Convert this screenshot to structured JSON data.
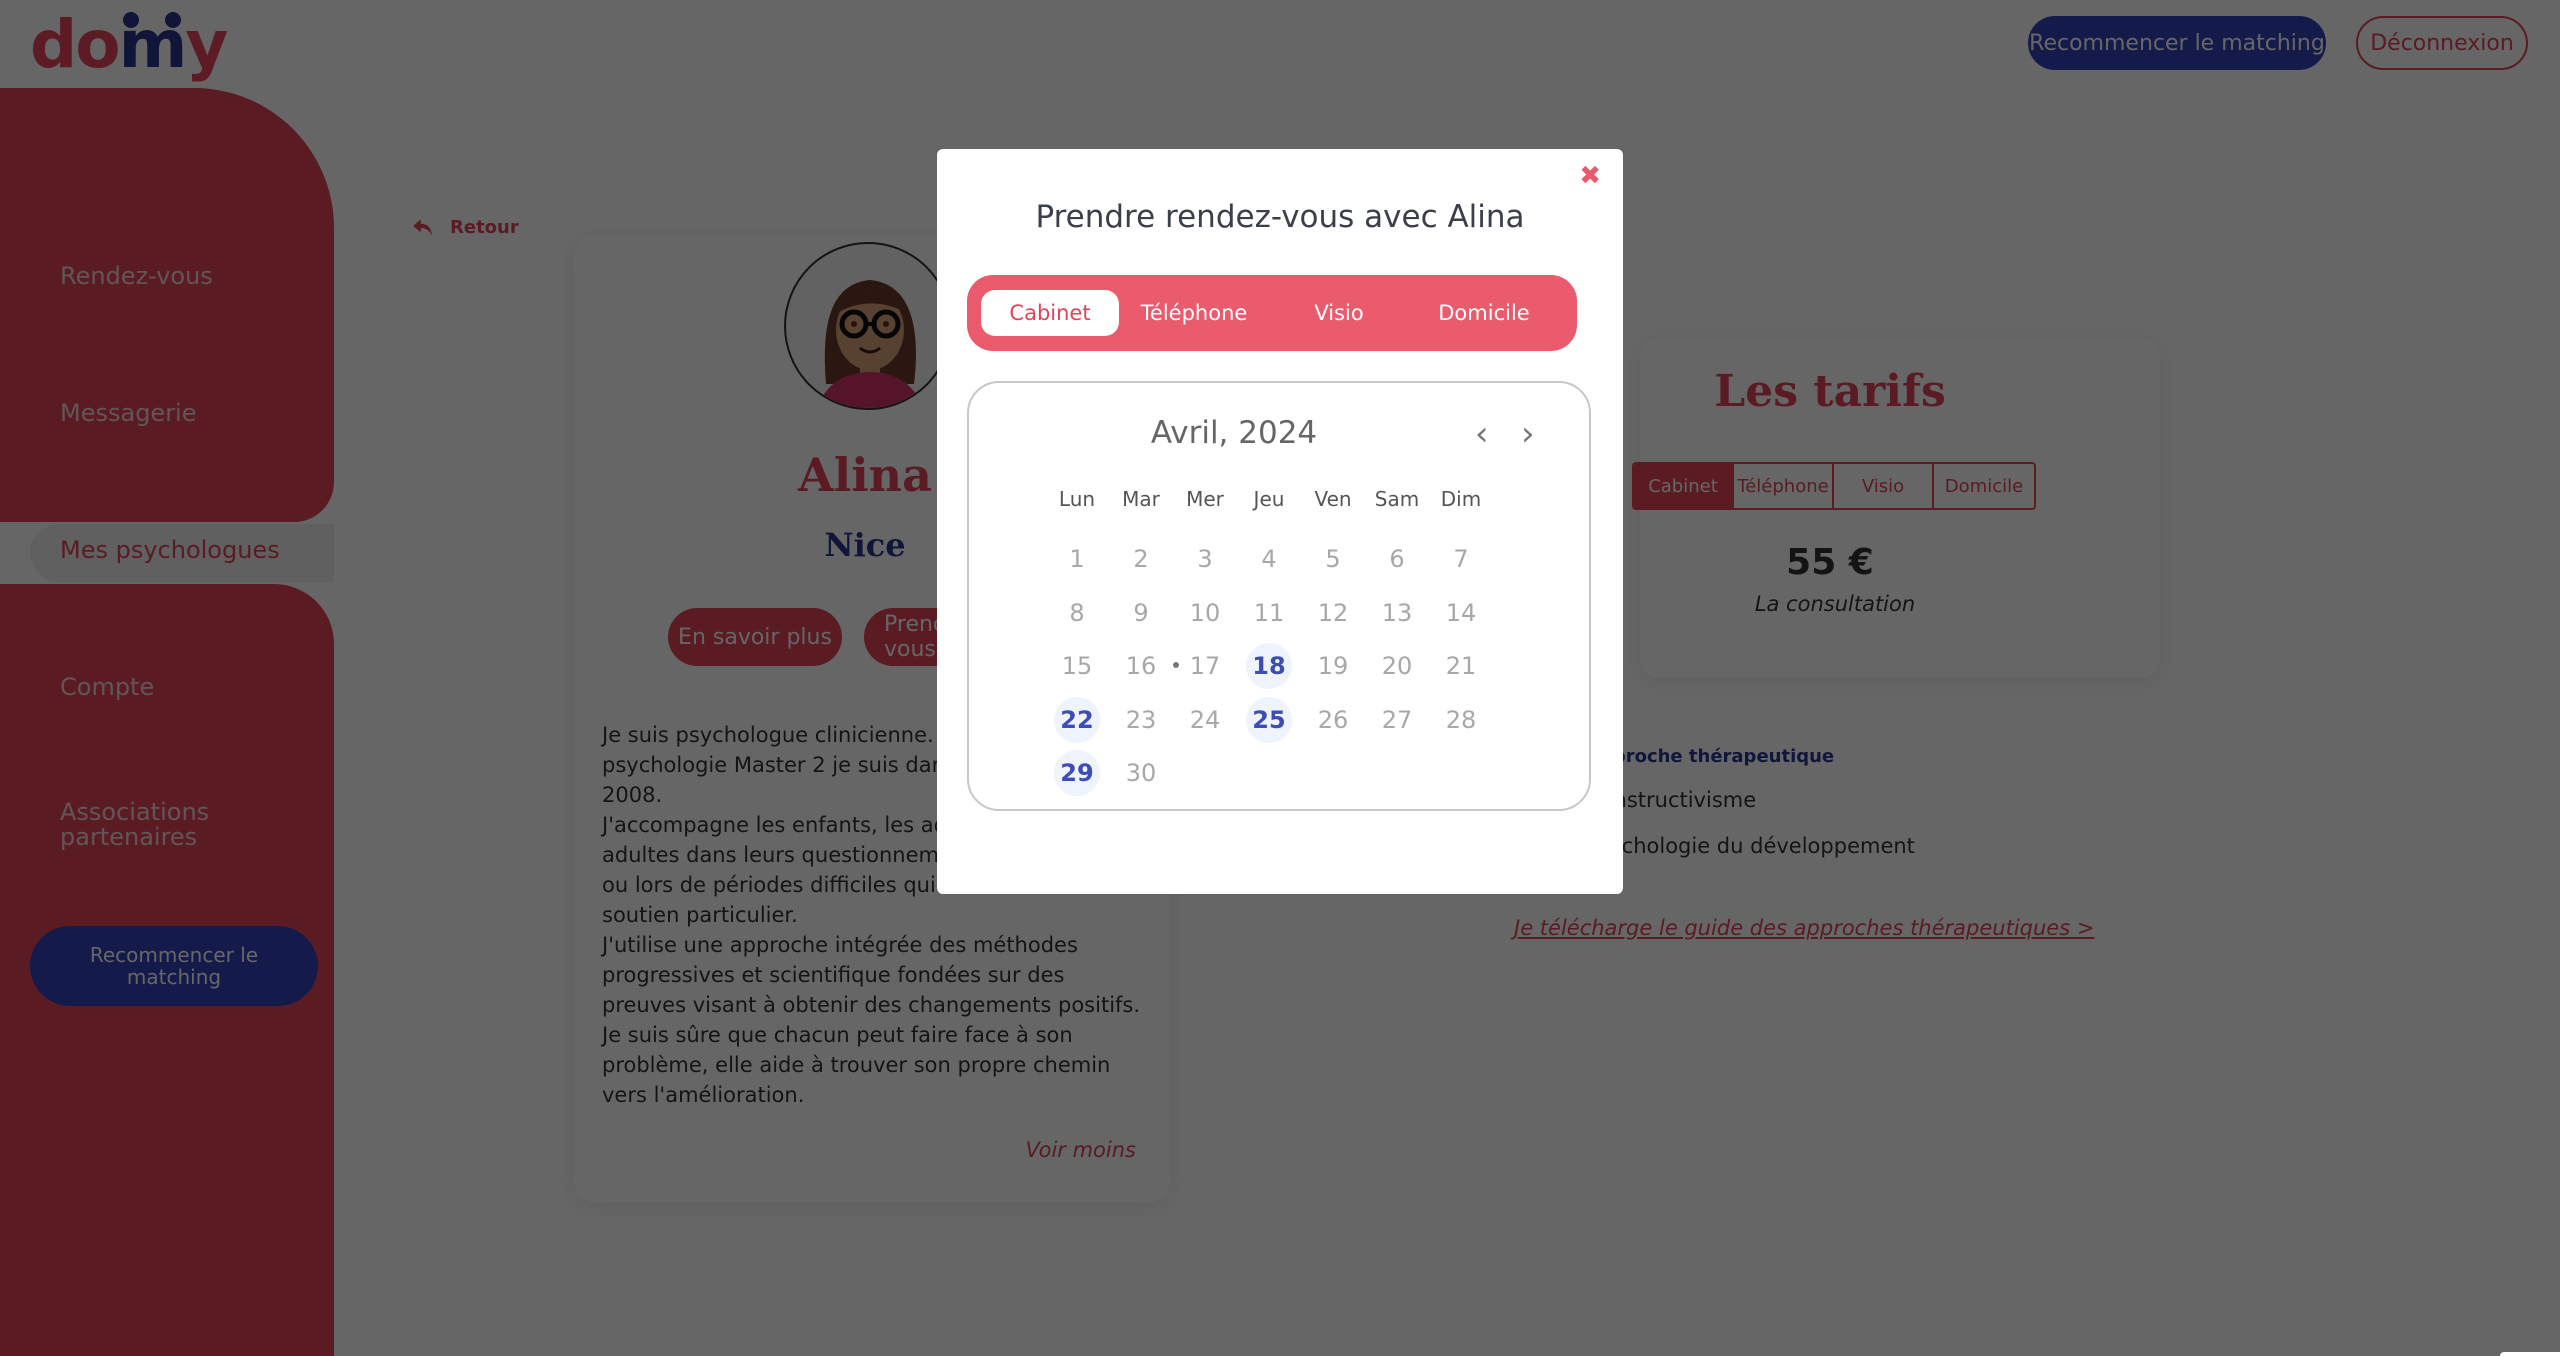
{
  "brand": {
    "logo_d": "do",
    "logo_m": "m",
    "logo_y": "y",
    "primary_color": "#e04458",
    "secondary_color": "#2c3690"
  },
  "header": {
    "restart_label": "Recommencer le matching",
    "logout_label": "Déconnexion"
  },
  "sidebar": {
    "items": [
      {
        "label": "Rendez-vous",
        "active": false
      },
      {
        "label": "Messagerie",
        "active": false
      },
      {
        "label": "Mes psychologues",
        "active": true
      },
      {
        "label": "Compte",
        "active": false
      },
      {
        "label": "Associations partenaires",
        "active": false
      }
    ],
    "restart_label": "Recommencer le matching"
  },
  "back": {
    "label": "Retour"
  },
  "profile": {
    "name": "Alina",
    "city": "Nice",
    "more_label": "En savoir plus",
    "book_label": "Prendre rendez-vous",
    "bio": "Je suis psychologue clinicienne. Diplômée en psychologie Master 2 je suis dans le métier depuis 2008.\nJ'accompagne les enfants, les adolescents et les adultes dans leurs questionnements du quotidien ou lors de périodes difficiles qui nécessitent un soutien particulier.\nJ'utilise une approche intégrée des méthodes progressives et scientifique fondées sur des preuves visant à obtenir des changements positifs.\nJe suis sûre que chacun peut faire face à son problème, elle aide à trouver son propre chemin vers l'amélioration.",
    "less_label": "Voir moins"
  },
  "tarifs": {
    "title": "Les tarifs",
    "modes": [
      "Cabinet",
      "Téléphone",
      "Visio",
      "Domicile"
    ],
    "selected_mode": "Cabinet",
    "price": "55 €",
    "price_caption": "La consultation"
  },
  "approach": {
    "title": "Approche thérapeutique",
    "items": [
      "Constructivisme",
      "Psychologie du développement"
    ],
    "guide_link": "Je télécharge le guide des approches thérapeutiques >"
  },
  "modal": {
    "title": "Prendre rendez-vous avec Alina",
    "close_icon": "close-icon",
    "modes": [
      "Cabinet",
      "Téléphone",
      "Visio",
      "Domicile"
    ],
    "selected_mode": "Cabinet",
    "calendar": {
      "month_label": "Avril, 2024",
      "weekdays": [
        "Lun",
        "Mar",
        "Mer",
        "Jeu",
        "Ven",
        "Sam",
        "Dim"
      ],
      "days_in_month": 30,
      "first_weekday_offset": 0,
      "today": 17,
      "available_days": [
        18,
        22,
        25,
        29
      ],
      "prev_icon": "chevron-left-icon",
      "next_icon": "chevron-right-icon"
    }
  }
}
